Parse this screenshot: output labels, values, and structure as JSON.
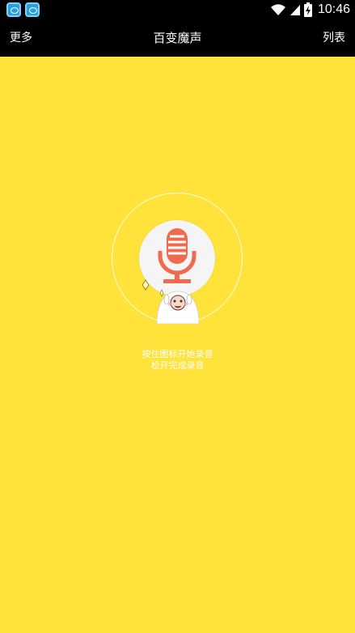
{
  "status_bar": {
    "time": "10:46",
    "notification_icons": [
      "app-notification-icon",
      "app-notification-icon"
    ],
    "system_icons": [
      "wifi-icon",
      "signal-icon",
      "battery-charging-icon"
    ]
  },
  "app_bar": {
    "left_label": "更多",
    "title": "百变魔声",
    "right_label": "列表"
  },
  "record": {
    "button_icon": "microphone-icon",
    "hint_line1": "按住图标开始录音",
    "hint_line2": "松开完成录音"
  },
  "colors": {
    "background": "#ffe23a",
    "accent": "#f06a4f",
    "bar": "#000000"
  }
}
